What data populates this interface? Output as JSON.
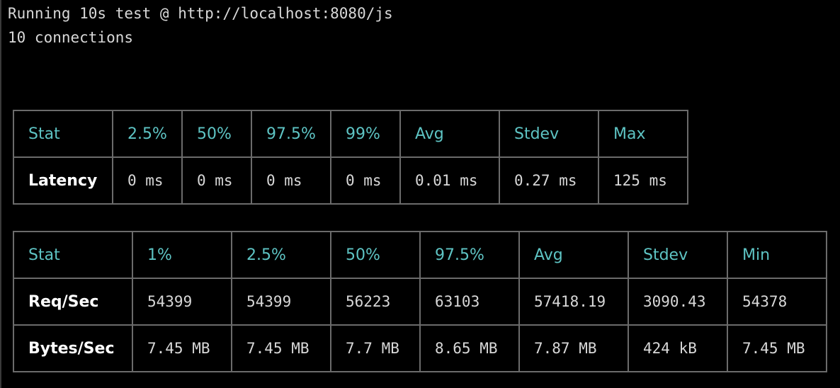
{
  "terminal": {
    "line1": "Running 10s test @ http://localhost:8080/js",
    "line2": "10 connections"
  },
  "latency_table": {
    "headers": [
      "Stat",
      "2.5%",
      "50%",
      "97.5%",
      "99%",
      "Avg",
      "Stdev",
      "Max"
    ],
    "rows": [
      {
        "label": "Latency",
        "values": [
          "0 ms",
          "0 ms",
          "0 ms",
          "0 ms",
          "0.01 ms",
          "0.27 ms",
          "125 ms"
        ]
      }
    ]
  },
  "throughput_table": {
    "headers": [
      "Stat",
      "1%",
      "2.5%",
      "50%",
      "97.5%",
      "Avg",
      "Stdev",
      "Min"
    ],
    "rows": [
      {
        "label": "Req/Sec",
        "values": [
          "54399",
          "54399",
          "56223",
          "63103",
          "57418.19",
          "3090.43",
          "54378"
        ]
      },
      {
        "label": "Bytes/Sec",
        "values": [
          "7.45 MB",
          "7.45 MB",
          "7.7 MB",
          "8.65 MB",
          "7.87 MB",
          "424 kB",
          "7.45 MB"
        ]
      }
    ]
  },
  "colors": {
    "background": "#000000",
    "header_text": "#5ec4c4",
    "body_text": "#d8d8d8",
    "row_label_text": "#ffffff",
    "border": "#6b6b6b"
  }
}
